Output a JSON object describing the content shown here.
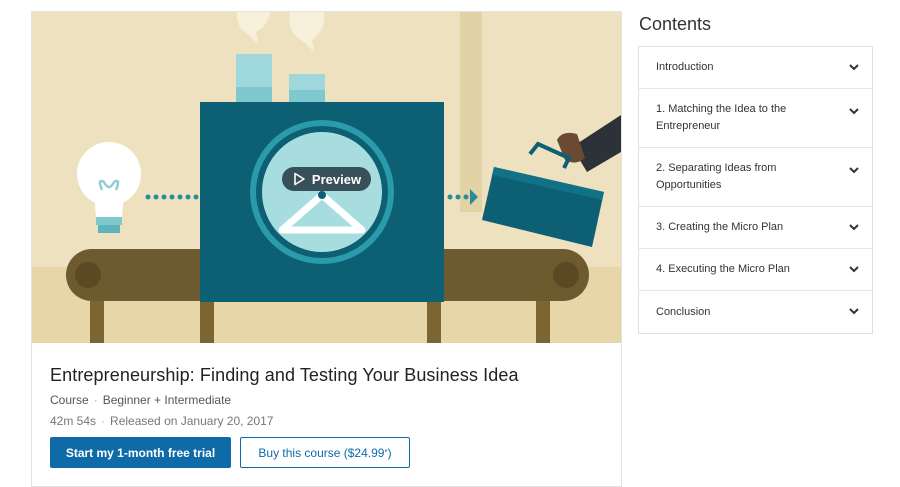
{
  "course": {
    "preview_label": "Preview",
    "title": "Entrepreneurship: Finding and Testing Your Business Idea",
    "type": "Course",
    "level": "Beginner + Intermediate",
    "duration": "42m 54s",
    "released": "Released on January 20, 2017",
    "trial_button": "Start my 1-month free trial",
    "buy_button_text": "Buy this course ($24.99",
    "buy_button_mark": "*",
    "buy_button_close": ")"
  },
  "contents": {
    "heading": "Contents",
    "items": [
      {
        "label": "Introduction"
      },
      {
        "label": "1. Matching the Idea to the Entrepreneur"
      },
      {
        "label": "2. Separating Ideas from Opportunities"
      },
      {
        "label": "3. Creating the Micro Plan"
      },
      {
        "label": "4. Executing the Micro Plan"
      },
      {
        "label": "Conclusion"
      }
    ]
  },
  "icons": {
    "play": "play-icon",
    "chevron": "chevron-down-icon",
    "bulb": "lightbulb-icon",
    "briefcase": "briefcase-icon"
  },
  "colors": {
    "accent": "#0e6ba8",
    "machine": "#0d5f73",
    "background": "#efe4c3"
  }
}
